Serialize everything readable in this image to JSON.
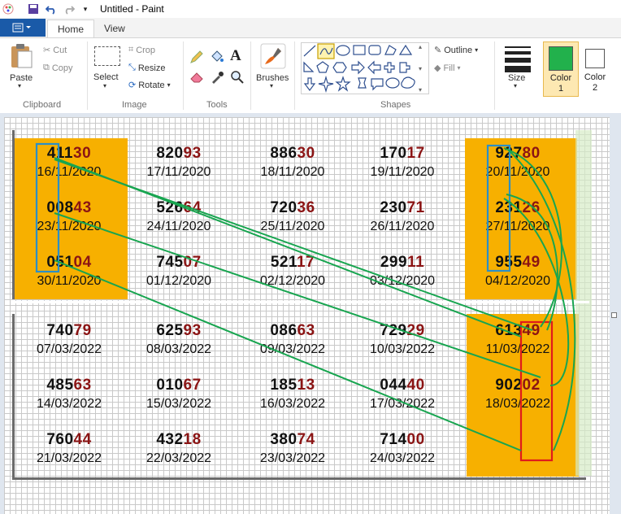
{
  "window": {
    "title": "Untitled - Paint"
  },
  "tabs": [
    {
      "label": "Home"
    },
    {
      "label": "View"
    }
  ],
  "ribbon": {
    "clipboard": {
      "paste": "Paste",
      "cut": "Cut",
      "copy": "Copy",
      "group": "Clipboard"
    },
    "image": {
      "select": "Select",
      "crop": "Crop",
      "resize": "Resize",
      "rotate": "Rotate",
      "group": "Image"
    },
    "tools": {
      "group": "Tools"
    },
    "brushes": {
      "label": "Brushes"
    },
    "shapes": {
      "outline": "Outline",
      "fill": "Fill",
      "group": "Shapes"
    },
    "size": {
      "label": "Size"
    },
    "color1": {
      "label1": "Color",
      "label2": "1",
      "hex": "#22b14c"
    },
    "color2": {
      "label1": "Color",
      "label2": "2",
      "hex": "#ffffff"
    }
  },
  "grid_top": [
    [
      {
        "num_a": "411",
        "num_b": "30",
        "date": "16/11/2020"
      },
      {
        "num_a": "820",
        "num_b": "93",
        "date": "17/11/2020"
      },
      {
        "num_a": "886",
        "num_b": "30",
        "date": "18/11/2020"
      },
      {
        "num_a": "170",
        "num_b": "17",
        "date": "19/11/2020"
      },
      {
        "num_a": "927",
        "num_b": "80",
        "date": "20/11/2020"
      }
    ],
    [
      {
        "num_a": "008",
        "num_b": "43",
        "date": "23/11/2020"
      },
      {
        "num_a": "526",
        "num_b": "64",
        "date": "24/11/2020"
      },
      {
        "num_a": "720",
        "num_b": "36",
        "date": "25/11/2020"
      },
      {
        "num_a": "230",
        "num_b": "71",
        "date": "26/11/2020"
      },
      {
        "num_a": "231",
        "num_b": "26",
        "date": "27/11/2020"
      }
    ],
    [
      {
        "num_a": "051",
        "num_b": "04",
        "date": "30/11/2020"
      },
      {
        "num_a": "745",
        "num_b": "07",
        "date": "01/12/2020"
      },
      {
        "num_a": "521",
        "num_b": "17",
        "date": "02/12/2020"
      },
      {
        "num_a": "299",
        "num_b": "11",
        "date": "03/12/2020"
      },
      {
        "num_a": "955",
        "num_b": "49",
        "date": "04/12/2020"
      }
    ]
  ],
  "grid_bottom": [
    [
      {
        "num_a": "740",
        "num_b": "79",
        "date": "07/03/2022"
      },
      {
        "num_a": "625",
        "num_b": "93",
        "date": "08/03/2022"
      },
      {
        "num_a": "086",
        "num_b": "63",
        "date": "09/03/2022"
      },
      {
        "num_a": "729",
        "num_b": "29",
        "date": "10/03/2022"
      },
      {
        "num_a": "613",
        "num_b": "49",
        "date": "11/03/2022"
      }
    ],
    [
      {
        "num_a": "485",
        "num_b": "63",
        "date": "14/03/2022"
      },
      {
        "num_a": "010",
        "num_b": "67",
        "date": "15/03/2022"
      },
      {
        "num_a": "185",
        "num_b": "13",
        "date": "16/03/2022"
      },
      {
        "num_a": "044",
        "num_b": "40",
        "date": "17/03/2022"
      },
      {
        "num_a": "902",
        "num_b": "02",
        "date": "18/03/2022"
      }
    ],
    [
      {
        "num_a": "760",
        "num_b": "44",
        "date": "21/03/2022"
      },
      {
        "num_a": "432",
        "num_b": "18",
        "date": "22/03/2022"
      },
      {
        "num_a": "380",
        "num_b": "74",
        "date": "23/03/2022"
      },
      {
        "num_a": "714",
        "num_b": "00",
        "date": "24/03/2022"
      },
      {
        "num_a": "",
        "num_b": "",
        "date": ""
      }
    ]
  ]
}
